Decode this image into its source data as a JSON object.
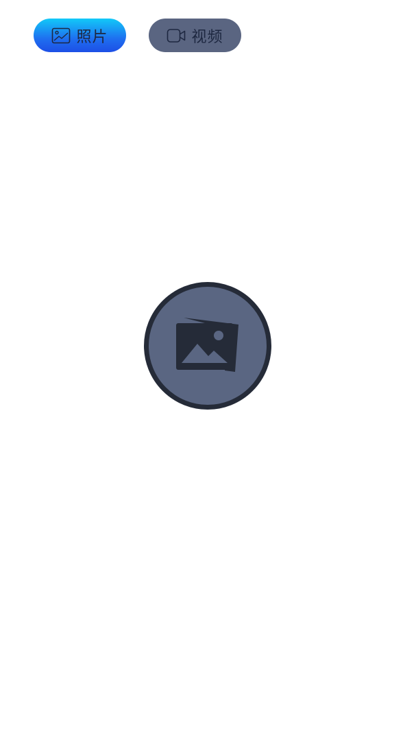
{
  "tabs": {
    "photo": {
      "label": "照片",
      "icon": "image-icon",
      "active": true
    },
    "video": {
      "label": "视频",
      "icon": "video-camera-icon",
      "active": false
    }
  },
  "main": {
    "action_icon": "photo-stack-icon"
  },
  "colors": {
    "active_tab_gradient_top": "#12c9f8",
    "active_tab_gradient_bottom": "#1d4fe6",
    "inactive_tab": "#5a6581",
    "tab_text": "#1d2740",
    "circle_fill": "#5a6682",
    "circle_border": "#252b38"
  }
}
